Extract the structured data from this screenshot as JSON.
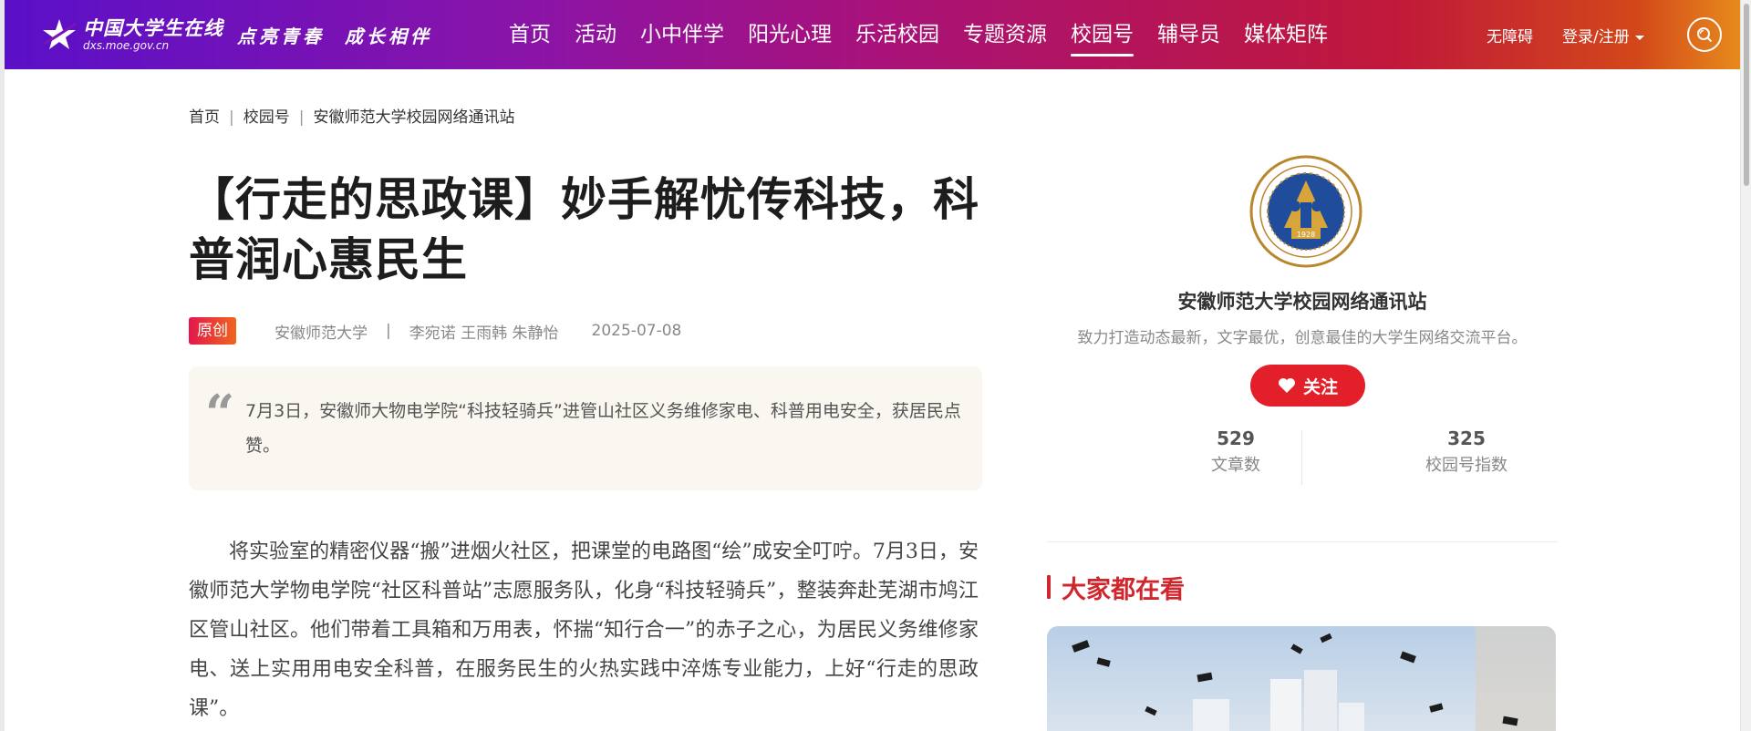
{
  "header": {
    "logo_cn": "中国大学生在线",
    "logo_url": "dxs.moe.gov.cn",
    "slogan_1": "点亮青春",
    "slogan_2": "成长相伴",
    "nav": [
      "首页",
      "活动",
      "小中伴学",
      "阳光心理",
      "乐活校园",
      "专题资源",
      "校园号",
      "辅导员",
      "媒体矩阵"
    ],
    "active_nav": "校园号",
    "accessible": "无障碍",
    "login": "登录/注册"
  },
  "breadcrumb": [
    "首页",
    "校园号",
    "安徽师范大学校园网络通讯站"
  ],
  "article": {
    "title": "【行走的思政课】妙手解忧传科技，科普润心惠民生",
    "badge": "原创",
    "school": "安徽师范大学",
    "authors": "李宛诺 王雨韩 朱静怡",
    "date": "2025-07-08",
    "summary": "7月3日，安徽师大物电学院“科技轻骑兵”进管山社区义务维修家电、科普用电安全，获居民点赞。",
    "body": "将实验室的精密仪器“搬”进烟火社区，把课堂的电路图“绘”成安全叮咛。7月3日，安徽师范大学物电学院“社区科普站”志愿服务队，化身“科技轻骑兵”，整装奔赴芜湖市鸠江区管山社区。他们带着工具箱和万用表，怀揣“知行合一”的赤子之心，为居民义务维修家电、送上实用用电安全科普，在服务民生的火热实践中淬炼专业能力，上好“行走的思政课”。"
  },
  "sidebar": {
    "logo_year": "1928",
    "name": "安徽师范大学校园网络通讯站",
    "desc": "致力打造动态最新，文字最优，创意最佳的大学生网络交流平台。",
    "follow": "关注",
    "stats": [
      {
        "value": "529",
        "label": "文章数"
      },
      {
        "value": "325",
        "label": "校园号指数"
      }
    ],
    "hot_title": "大家都在看"
  },
  "colors": {
    "brand_red": "#e3202a",
    "accent_red": "#d0262d"
  }
}
